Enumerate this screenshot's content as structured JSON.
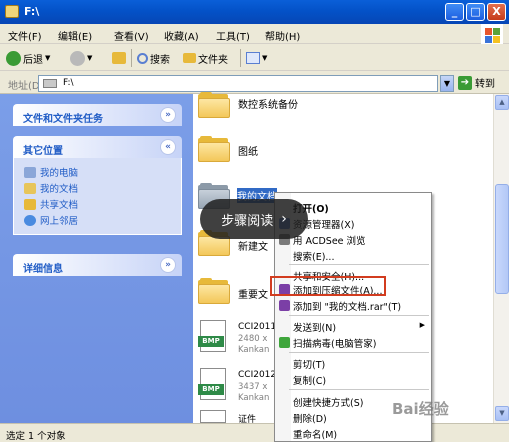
{
  "window": {
    "title": "F:\\",
    "controls": {
      "minimize": "_",
      "maximize": "□",
      "close": "X"
    }
  },
  "menubar": [
    "文件(F)",
    "编辑(E)",
    "查看(V)",
    "收藏(A)",
    "工具(T)",
    "帮助(H)"
  ],
  "toolbar": {
    "back_label": "后退",
    "search_label": "搜索",
    "folders_label": "文件夹"
  },
  "address": {
    "label": "地址(D)",
    "value": "F:\\",
    "go_label": "转到"
  },
  "sidebar": {
    "panels": [
      {
        "title": "文件和文件夹任务",
        "expanded": false,
        "items": []
      },
      {
        "title": "其它位置",
        "expanded": true,
        "items": [
          {
            "label": "我的电脑",
            "icon": "my-computer-icon"
          },
          {
            "label": "我的文档",
            "icon": "my-documents-icon"
          },
          {
            "label": "共享文档",
            "icon": "shared-documents-icon"
          },
          {
            "label": "网上邻居",
            "icon": "network-places-icon"
          }
        ]
      },
      {
        "title": "详细信息",
        "expanded": false,
        "items": []
      }
    ]
  },
  "files": [
    {
      "name": "数控系统备份",
      "type": "folder"
    },
    {
      "name": "图纸",
      "type": "folder"
    },
    {
      "name": "我的文档",
      "type": "folder",
      "selected": true
    },
    {
      "name": "新建文",
      "type": "folder"
    },
    {
      "name": "重要文",
      "type": "folder"
    },
    {
      "name": "CCI2011",
      "type": "bmp",
      "meta1": "2480 x",
      "meta2": "Kankan"
    },
    {
      "name": "CCI2012",
      "type": "bmp",
      "meta1": "3437 x",
      "meta2": "Kankan"
    },
    {
      "name": "证件",
      "type": "bmp"
    }
  ],
  "context_menu": {
    "items": [
      {
        "label": "打开(O)",
        "bold": true
      },
      {
        "label": "资源管理器(X)"
      },
      {
        "label": "用 ACDSee 浏览"
      },
      {
        "label": "搜索(E)..."
      },
      {
        "label": "共享和安全(H)..."
      },
      {
        "label": "添加到压缩文件(A)...",
        "highlighted": true
      },
      {
        "label": "添加到 \"我的文档.rar\"(T)"
      },
      {
        "label": "发送到(N)",
        "submenu": true
      },
      {
        "label": "扫描病毒(电脑管家)"
      },
      {
        "label": "剪切(T)"
      },
      {
        "label": "复制(C)"
      },
      {
        "label": "创建快捷方式(S)"
      },
      {
        "label": "删除(D)"
      },
      {
        "label": "重命名(M)"
      }
    ]
  },
  "overlay": {
    "label": "步骤阅读"
  },
  "status": {
    "text": "选定 1 个对象"
  },
  "watermark": {
    "text": "Bai经验"
  },
  "colors": {
    "highlight_border": "#d23c1f",
    "selection": "#316ac5",
    "titlebar": "#0452c8"
  }
}
